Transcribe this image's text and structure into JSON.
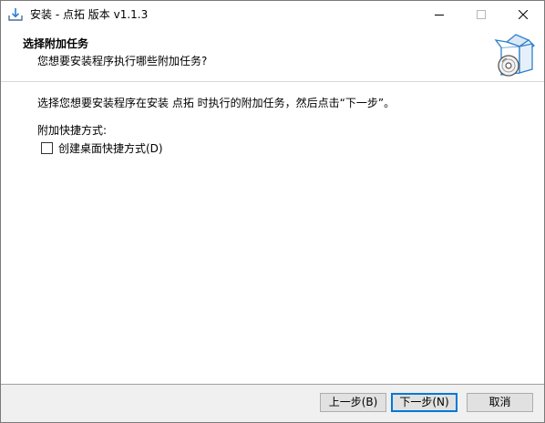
{
  "window": {
    "title": "安装 - 点拓 版本 v1.1.3"
  },
  "header": {
    "title": "选择附加任务",
    "subtitle": "您想要安装程序执行哪些附加任务?"
  },
  "body": {
    "instruction": "选择您想要安装程序在安装 点拓 时执行的附加任务，然后点击“下一步”。",
    "group_label": "附加快捷方式:",
    "tasks": [
      {
        "label": "创建桌面快捷方式(D)",
        "checked": false
      }
    ]
  },
  "footer": {
    "back_label": "上一步(B)",
    "next_label": "下一步(N)",
    "cancel_label": "取消"
  },
  "icons": {
    "app": "installer-download-icon",
    "minimize": "minimize-icon",
    "maximize": "maximize-icon",
    "close": "close-icon",
    "wizard": "software-box-disc-icon"
  },
  "colors": {
    "accent": "#0078d7",
    "window_bg": "#f0f0f0",
    "panel_bg": "#ffffff"
  }
}
